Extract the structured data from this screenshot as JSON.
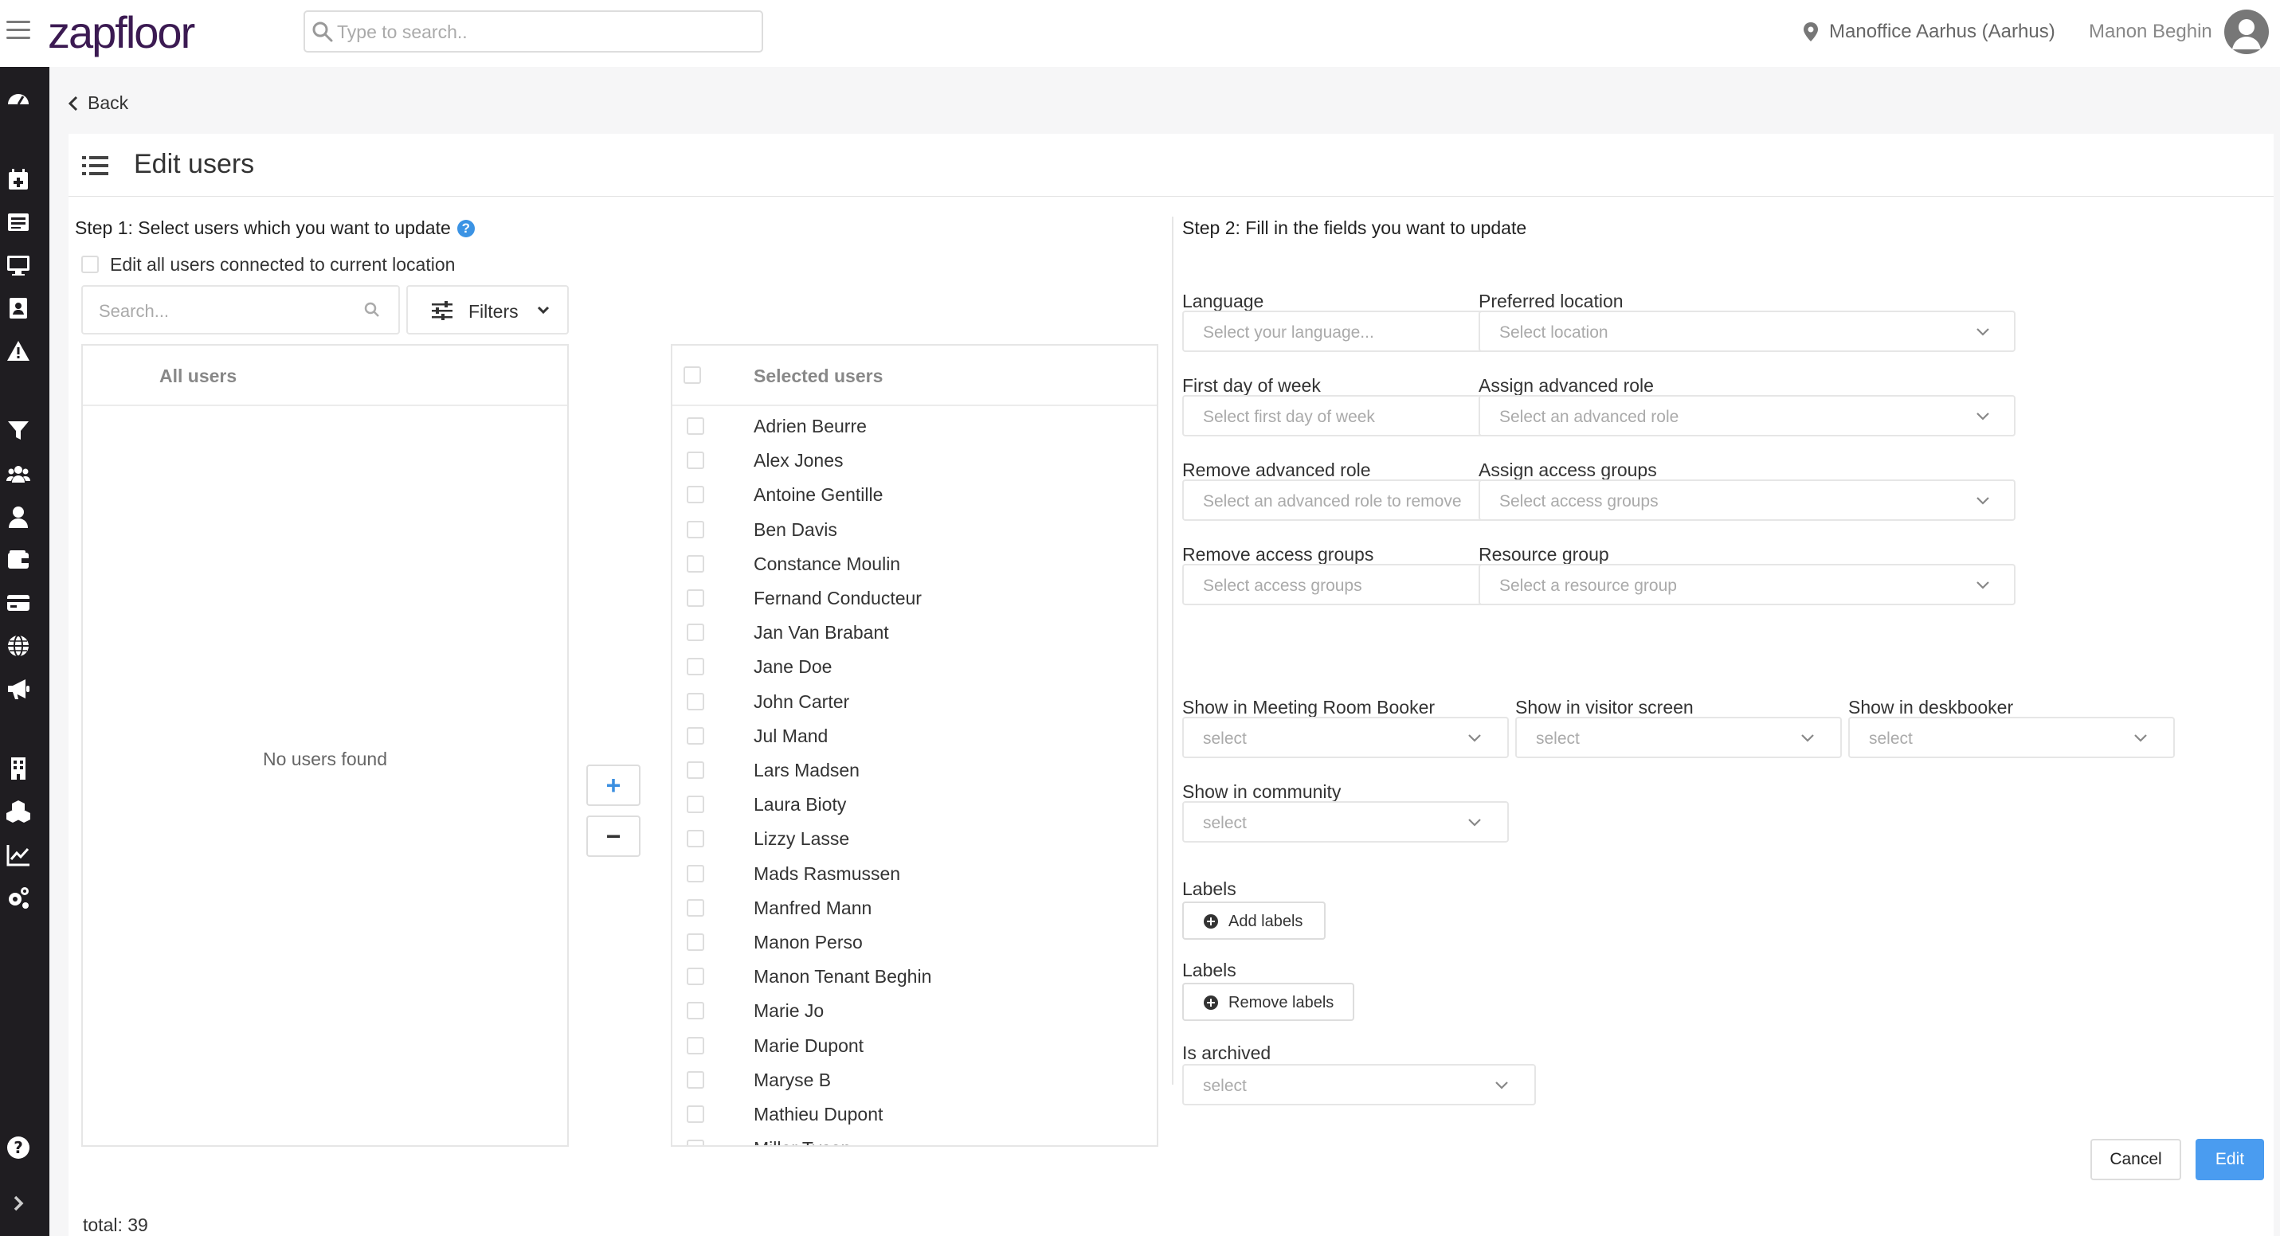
{
  "app": {
    "logo": "zapfloor",
    "search_placeholder": "Type to search..",
    "location": "Manoffice Aarhus (Aarhus)",
    "user_name": "Manon Beghin"
  },
  "sidebar": {
    "icons": [
      "dashboard-icon",
      "calendar-icon",
      "list-icon",
      "monitor-icon",
      "contacts-icon",
      "warning-icon",
      "funnel-icon",
      "group-icon",
      "person-icon",
      "wallet-icon",
      "card-icon",
      "globe-icon",
      "megaphone-icon",
      "building-icon",
      "cubes-icon",
      "chart-icon",
      "cogs-icon",
      "help-icon",
      "expand-icon"
    ]
  },
  "page": {
    "back_label": "Back",
    "title": "Edit users"
  },
  "step1": {
    "heading": "Step 1: Select users which you want to update",
    "help": "?",
    "edit_all_label": "Edit all users connected to current location",
    "search_placeholder": "Search...",
    "filters_label": "Filters",
    "all_users_title": "All users",
    "no_users_text": "No users found",
    "selected_users_title": "Selected users",
    "add_symbol": "+",
    "remove_symbol": "−",
    "selected_users": [
      "Adrien Beurre",
      "Alex Jones",
      "Antoine Gentille",
      "Ben Davis",
      "Constance Moulin",
      "Fernand Conducteur",
      "Jan Van Brabant",
      "Jane Doe",
      "John Carter",
      "Jul Mand",
      "Lars Madsen",
      "Laura Bioty",
      "Lizzy Lasse",
      "Mads Rasmussen",
      "Manfred Mann",
      "Manon Perso",
      "Manon Tenant Beghin",
      "Marie Jo",
      "Marie Dupont",
      "Maryse B",
      "Mathieu Dupont",
      "Miller Tyson"
    ],
    "total_label": "total: 39"
  },
  "step2": {
    "heading": "Step 2: Fill in the fields you want to update",
    "fields": [
      {
        "label": "Language",
        "placeholder": "Select your language..."
      },
      {
        "label": "Preferred location",
        "placeholder": "Select location"
      },
      {
        "label": "First day of week",
        "placeholder": "Select first day of week"
      },
      {
        "label": "Assign advanced role",
        "placeholder": "Select an advanced role"
      },
      {
        "label": "Remove advanced role",
        "placeholder": "Select an advanced role to remove"
      },
      {
        "label": "Assign access groups",
        "placeholder": "Select access groups"
      },
      {
        "label": "Remove access groups",
        "placeholder": "Select access groups"
      },
      {
        "label": "Resource group",
        "placeholder": "Select a resource group"
      }
    ],
    "show_fields": [
      {
        "label": "Show in Meeting Room Booker",
        "placeholder": "select"
      },
      {
        "label": "Show in visitor screen",
        "placeholder": "select"
      },
      {
        "label": "Show in deskbooker",
        "placeholder": "select"
      },
      {
        "label": "Show in community",
        "placeholder": "select"
      }
    ],
    "labels_add": {
      "label": "Labels",
      "button": "Add labels"
    },
    "labels_remove": {
      "label": "Labels",
      "button": "Remove labels"
    },
    "archived": {
      "label": "Is archived",
      "placeholder": "select"
    },
    "cancel_label": "Cancel",
    "edit_label": "Edit"
  },
  "colors": {
    "sidebar_bg": "#1f1d21",
    "logo": "#3b1a52",
    "help_badge": "#3b93e4",
    "primary_button": "#4a9cf0"
  }
}
